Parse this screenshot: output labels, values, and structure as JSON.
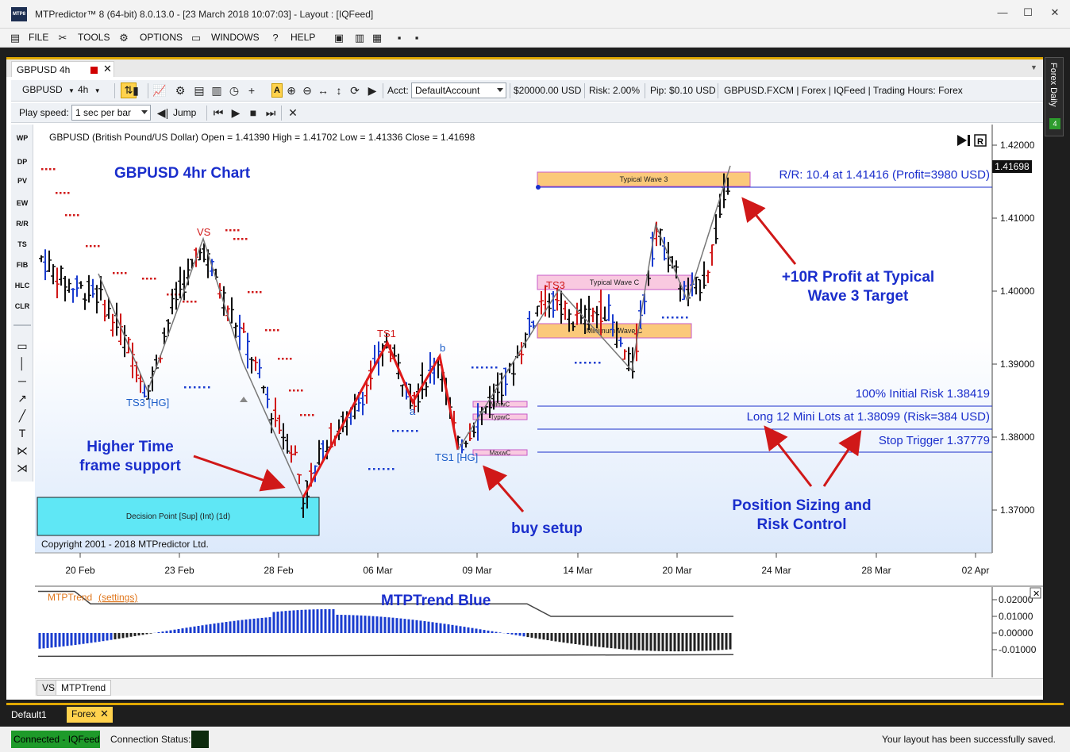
{
  "window": {
    "logo": "MTP8",
    "title": "MTPredictor™ 8 (64-bit) 8.0.13.0 - [23 March 2018 10:07:03] - Layout : [IQFeed]",
    "minimize": "—",
    "maximize": "☐",
    "close": "✕"
  },
  "menu": {
    "file": "FILE",
    "tools": "TOOLS",
    "options": "OPTIONS",
    "windows": "WINDOWS",
    "help": "HELP"
  },
  "doc_tab": {
    "label": "GBPUSD 4h",
    "close": "✕"
  },
  "right_dock": {
    "label": "Forex Daily",
    "badge": "4"
  },
  "toolbar": {
    "symbol": "GBPUSD",
    "timeframe": "4h",
    "acct_label": "Acct:",
    "acct_value": "DefaultAccount",
    "balance": "$20000.00 USD",
    "risk": "Risk:  2.00%",
    "pip": "Pip:  $0.10 USD",
    "instrument": "GBPUSD.FXCM | Forex | IQFeed | Trading Hours: Forex",
    "play_speed_label": "Play speed:",
    "play_speed_value": "1 sec per bar",
    "jump": "Jump",
    "a_button": "A"
  },
  "left_tools": [
    "WP",
    "DP",
    "PV",
    "EW",
    "R/R",
    "TS",
    "FIB",
    "HLC",
    "CLR"
  ],
  "chart": {
    "header": "GBPUSD (British Pound/US Dollar) Open = 1.41390 High = 1.41702 Low = 1.41336 Close = 1.41698",
    "title": "GBPUSD 4hr Chart",
    "copyright": "Copyright 2001 - 2018 MTPredictor Ltd.",
    "last_price": "1.41698",
    "y_ticks": [
      "1.42000",
      "1.41000",
      "1.40000",
      "1.39000",
      "1.38000",
      "1.37000"
    ],
    "x_ticks": [
      "20 Feb",
      "23 Feb",
      "28 Feb",
      "06 Mar",
      "09 Mar",
      "14 Mar",
      "20 Mar",
      "24 Mar",
      "28 Mar",
      "02 Apr"
    ],
    "labels": {
      "vs": "VS",
      "ts1_top": "TS1",
      "ts1_hg": "TS1 [HG]",
      "ts3_hg": "TS3 [HG]",
      "ts3": "TS3",
      "a": "a",
      "b": "b"
    },
    "zones": {
      "typical_wave3": "Typical Wave 3",
      "typical_wavec": "Typical Wave C",
      "minimum_wavec": "Minimum Wave C",
      "minwc": "MinwC",
      "typwc": "TypwC",
      "maxwc": "MaxwC",
      "decision_point": "Decision Point [Sup] (Int) (1d)"
    },
    "trade_lines": {
      "rr": "R/R: 10.4 at 1.41416 (Profit=3980 USD)",
      "initial_risk": "100% Initial Risk 1.38419",
      "long": "Long 12 Mini Lots at 1.38099 (Risk=384 USD)",
      "stop": "Stop Trigger 1.37779"
    },
    "annotations": {
      "higher_tf_1": "Higher Time",
      "higher_tf_2": "frame support",
      "buy_setup": "buy setup",
      "profit_1": "+10R Profit at Typical",
      "profit_2": "Wave 3 Target",
      "position_1": "Position Sizing and",
      "position_2": "Risk Control"
    },
    "colors": {
      "accent_blue": "#1a2ecc",
      "bull_bar": "#1a3ccf",
      "bear_bar": "#d01818",
      "neutral_bar": "#111111",
      "wave_red": "#e01a1a",
      "zone_orange": "#fbc97a",
      "zone_pink": "#f9c9e0",
      "zone_cyan": "#5fe7f5"
    }
  },
  "indicator": {
    "name": "MTPTrend",
    "settings": "(settings)",
    "title": "MTPTrend Blue",
    "y_ticks": [
      "0.02000",
      "0.01000",
      "0.00000",
      "-0.01000"
    ],
    "close": "✕"
  },
  "pane_tabs": {
    "vs": "VS",
    "mtptrend": "MTPTrend"
  },
  "layout_tabs": {
    "default": "Default1",
    "forex": "Forex",
    "close": "✕"
  },
  "status": {
    "connected": "Connected - IQFeed",
    "connection_status": "Connection Status:",
    "message": "Your layout has been successfully saved."
  }
}
